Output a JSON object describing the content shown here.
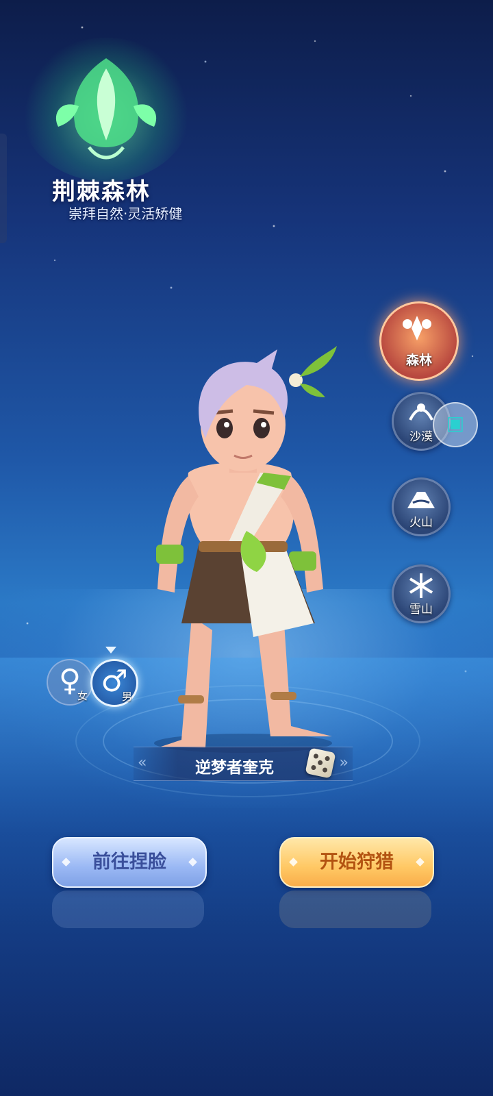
{
  "realm": {
    "title": "荆棘森林",
    "subtitle": "崇拜自然·灵活矫健"
  },
  "realm_selector": [
    {
      "label": "森林",
      "icon": "forest-icon",
      "active": true
    },
    {
      "label": "沙漠",
      "icon": "desert-icon",
      "active": false
    },
    {
      "label": "火山",
      "icon": "volcano-icon",
      "active": false
    },
    {
      "label": "雪山",
      "icon": "snow-mountain-icon",
      "active": false
    }
  ],
  "gender": {
    "female_label": "女",
    "male_label": "男",
    "female_symbol": "♀",
    "male_symbol": "♂",
    "selected": "male"
  },
  "character": {
    "name": "逆梦者奎克"
  },
  "actions": {
    "customize_face": "前往捏脸",
    "start_hunt": "开始狩猎"
  },
  "colors": {
    "active_realm": "#f08a5d",
    "hunt_button": "#ffc864",
    "face_button": "#9ab8f4"
  }
}
